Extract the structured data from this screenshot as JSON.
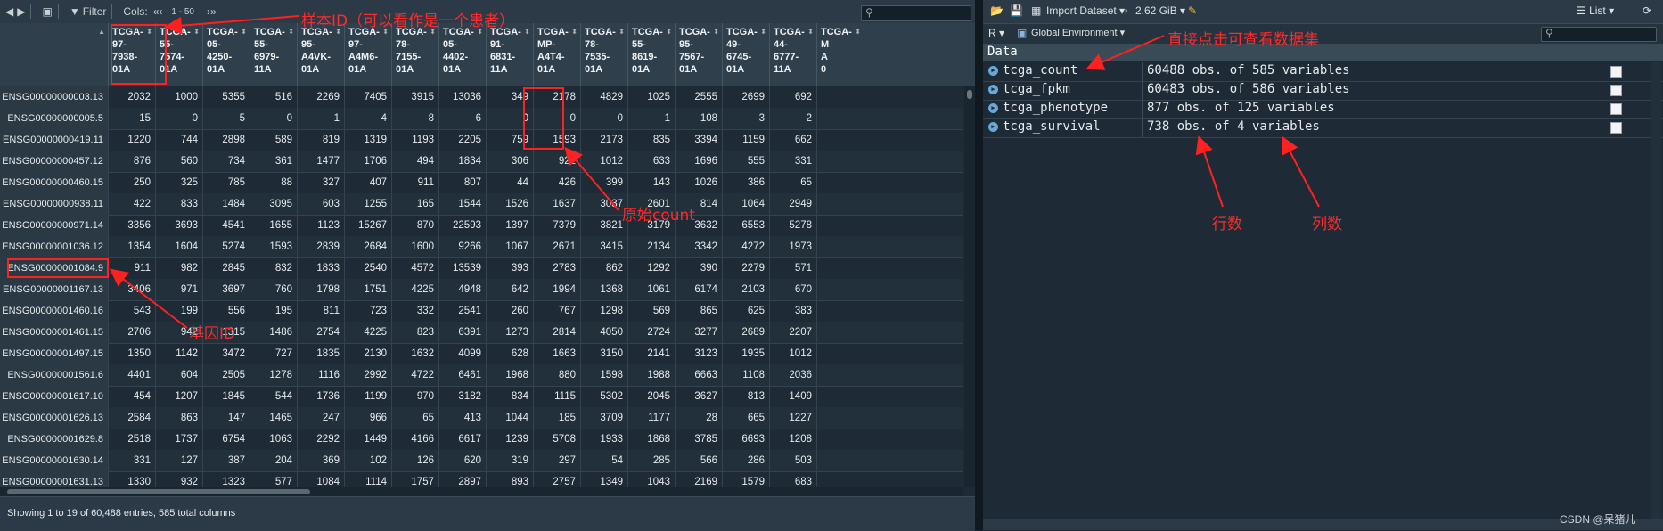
{
  "left_toolbar": {
    "filter_label": "Filter",
    "cols_label": "Cols:",
    "range_label": "1 - 50",
    "nav_prev": "«‹",
    "nav_next": "›»"
  },
  "table": {
    "columns": [
      {
        "label": "TCGA-\n97-\n7938-\n01A"
      },
      {
        "label": "TCGA-\n55-\n7574-\n01A"
      },
      {
        "label": "TCGA-\n05-\n4250-\n01A"
      },
      {
        "label": "TCGA-\n55-\n6979-\n11A"
      },
      {
        "label": "TCGA-\n95-\nA4VK-\n01A"
      },
      {
        "label": "TCGA-\n97-\nA4M6-\n01A"
      },
      {
        "label": "TCGA-\n78-\n7155-\n01A"
      },
      {
        "label": "TCGA-\n05-\n4402-\n01A"
      },
      {
        "label": "TCGA-\n91-\n6831-\n11A"
      },
      {
        "label": "TCGA-\nMP-\nA4T4-\n01A"
      },
      {
        "label": "TCGA-\n78-\n7535-\n01A"
      },
      {
        "label": "TCGA-\n55-\n8619-\n01A"
      },
      {
        "label": "TCGA-\n95-\n7567-\n01A"
      },
      {
        "label": "TCGA-\n49-\n6745-\n01A"
      },
      {
        "label": "TCGA-\n44-\n6777-\n11A"
      },
      {
        "label": "TCGA-\nM\nA\n0"
      }
    ],
    "rows": [
      {
        "gene": "ENSG00000000003.13",
        "values": [
          "2032",
          "1000",
          "5355",
          "516",
          "2269",
          "7405",
          "3915",
          "13036",
          "349",
          "2178",
          "4829",
          "1025",
          "2555",
          "2699",
          "692"
        ]
      },
      {
        "gene": "ENSG00000000005.5",
        "values": [
          "15",
          "0",
          "5",
          "0",
          "1",
          "4",
          "8",
          "6",
          "0",
          "0",
          "0",
          "1",
          "108",
          "3",
          "2"
        ]
      },
      {
        "gene": "ENSG00000000419.11",
        "values": [
          "1220",
          "744",
          "2898",
          "589",
          "819",
          "1319",
          "1193",
          "2205",
          "759",
          "1593",
          "2173",
          "835",
          "3394",
          "1159",
          "662"
        ]
      },
      {
        "gene": "ENSG00000000457.12",
        "values": [
          "876",
          "560",
          "734",
          "361",
          "1477",
          "1706",
          "494",
          "1834",
          "306",
          "922",
          "1012",
          "633",
          "1696",
          "555",
          "331"
        ]
      },
      {
        "gene": "ENSG00000000460.15",
        "values": [
          "250",
          "325",
          "785",
          "88",
          "327",
          "407",
          "911",
          "807",
          "44",
          "426",
          "399",
          "143",
          "1026",
          "386",
          "65"
        ]
      },
      {
        "gene": "ENSG00000000938.11",
        "values": [
          "422",
          "833",
          "1484",
          "3095",
          "603",
          "1255",
          "165",
          "1544",
          "1526",
          "1637",
          "3037",
          "2601",
          "814",
          "1064",
          "2949"
        ]
      },
      {
        "gene": "ENSG00000000971.14",
        "values": [
          "3356",
          "3693",
          "4541",
          "1655",
          "1123",
          "15267",
          "870",
          "22593",
          "1397",
          "7379",
          "3821",
          "3179",
          "3632",
          "6553",
          "5278"
        ]
      },
      {
        "gene": "ENSG00000001036.12",
        "values": [
          "1354",
          "1604",
          "5274",
          "1593",
          "2839",
          "2684",
          "1600",
          "9266",
          "1067",
          "2671",
          "3415",
          "2134",
          "3342",
          "4272",
          "1973"
        ]
      },
      {
        "gene": "ENSG00000001084.9",
        "values": [
          "911",
          "982",
          "2845",
          "832",
          "1833",
          "2540",
          "4572",
          "13539",
          "393",
          "2783",
          "862",
          "1292",
          "390",
          "2279",
          "571"
        ]
      },
      {
        "gene": "ENSG00000001167.13",
        "values": [
          "3406",
          "971",
          "3697",
          "760",
          "1798",
          "1751",
          "4225",
          "4948",
          "642",
          "1994",
          "1368",
          "1061",
          "6174",
          "2103",
          "670"
        ]
      },
      {
        "gene": "ENSG00000001460.16",
        "values": [
          "543",
          "199",
          "556",
          "195",
          "811",
          "723",
          "332",
          "2541",
          "260",
          "767",
          "1298",
          "569",
          "865",
          "625",
          "383"
        ]
      },
      {
        "gene": "ENSG00000001461.15",
        "values": [
          "2706",
          "942",
          "1315",
          "1486",
          "2754",
          "4225",
          "823",
          "6391",
          "1273",
          "2814",
          "4050",
          "2724",
          "3277",
          "2689",
          "2207"
        ]
      },
      {
        "gene": "ENSG00000001497.15",
        "values": [
          "1350",
          "1142",
          "3472",
          "727",
          "1835",
          "2130",
          "1632",
          "4099",
          "628",
          "1663",
          "3150",
          "2141",
          "3123",
          "1935",
          "1012"
        ]
      },
      {
        "gene": "ENSG00000001561.6",
        "values": [
          "4401",
          "604",
          "2505",
          "1278",
          "1116",
          "2992",
          "4722",
          "6461",
          "1968",
          "880",
          "1598",
          "1988",
          "6663",
          "1108",
          "2036"
        ]
      },
      {
        "gene": "ENSG00000001617.10",
        "values": [
          "454",
          "1207",
          "1845",
          "544",
          "1736",
          "1199",
          "970",
          "3182",
          "834",
          "1115",
          "5302",
          "2045",
          "3627",
          "813",
          "1409"
        ]
      },
      {
        "gene": "ENSG00000001626.13",
        "values": [
          "2584",
          "863",
          "147",
          "1465",
          "247",
          "966",
          "65",
          "413",
          "1044",
          "185",
          "3709",
          "1177",
          "28",
          "665",
          "1227"
        ]
      },
      {
        "gene": "ENSG00000001629.8",
        "values": [
          "2518",
          "1737",
          "6754",
          "1063",
          "2292",
          "1449",
          "4166",
          "6617",
          "1239",
          "5708",
          "1933",
          "1868",
          "3785",
          "6693",
          "1208"
        ]
      },
      {
        "gene": "ENSG00000001630.14",
        "values": [
          "331",
          "127",
          "387",
          "204",
          "369",
          "102",
          "126",
          "620",
          "319",
          "297",
          "54",
          "285",
          "566",
          "286",
          "503"
        ]
      },
      {
        "gene": "ENSG00000001631.13",
        "values": [
          "1330",
          "932",
          "1323",
          "577",
          "1084",
          "1114",
          "1757",
          "2897",
          "893",
          "2757",
          "1349",
          "1043",
          "2169",
          "1579",
          "683"
        ]
      }
    ],
    "status_text": "Showing 1 to 19 of 60,488 entries, 585 total columns"
  },
  "right_toolbar": {
    "import_label": "Import Dataset",
    "memory_label": "2.62 GiB",
    "view_label": "List",
    "lang_label": "R",
    "env_label": "Global Environment"
  },
  "environment": {
    "section_title": "Data",
    "items": [
      {
        "name": "tcga_count",
        "desc": "60488 obs. of 585 variables"
      },
      {
        "name": "tcga_fpkm",
        "desc": "60483 obs. of 586 variables"
      },
      {
        "name": "tcga_phenotype",
        "desc": "877 obs. of 125 variables"
      },
      {
        "name": "tcga_survival",
        "desc": "738 obs. of 4 variables"
      }
    ]
  },
  "annotations": {
    "sample_id": "样本ID（可以看作是一个患者）",
    "raw_count": "原始count",
    "gene_id": "基因ID",
    "click_hint": "直接点击可查看数据集",
    "rows_label": "行数",
    "cols_label": "列数"
  },
  "watermark": "CSDN @呆猪儿",
  "colors": {
    "annotation_red": "#ff2020",
    "panel_bg": "#1e2b36"
  }
}
